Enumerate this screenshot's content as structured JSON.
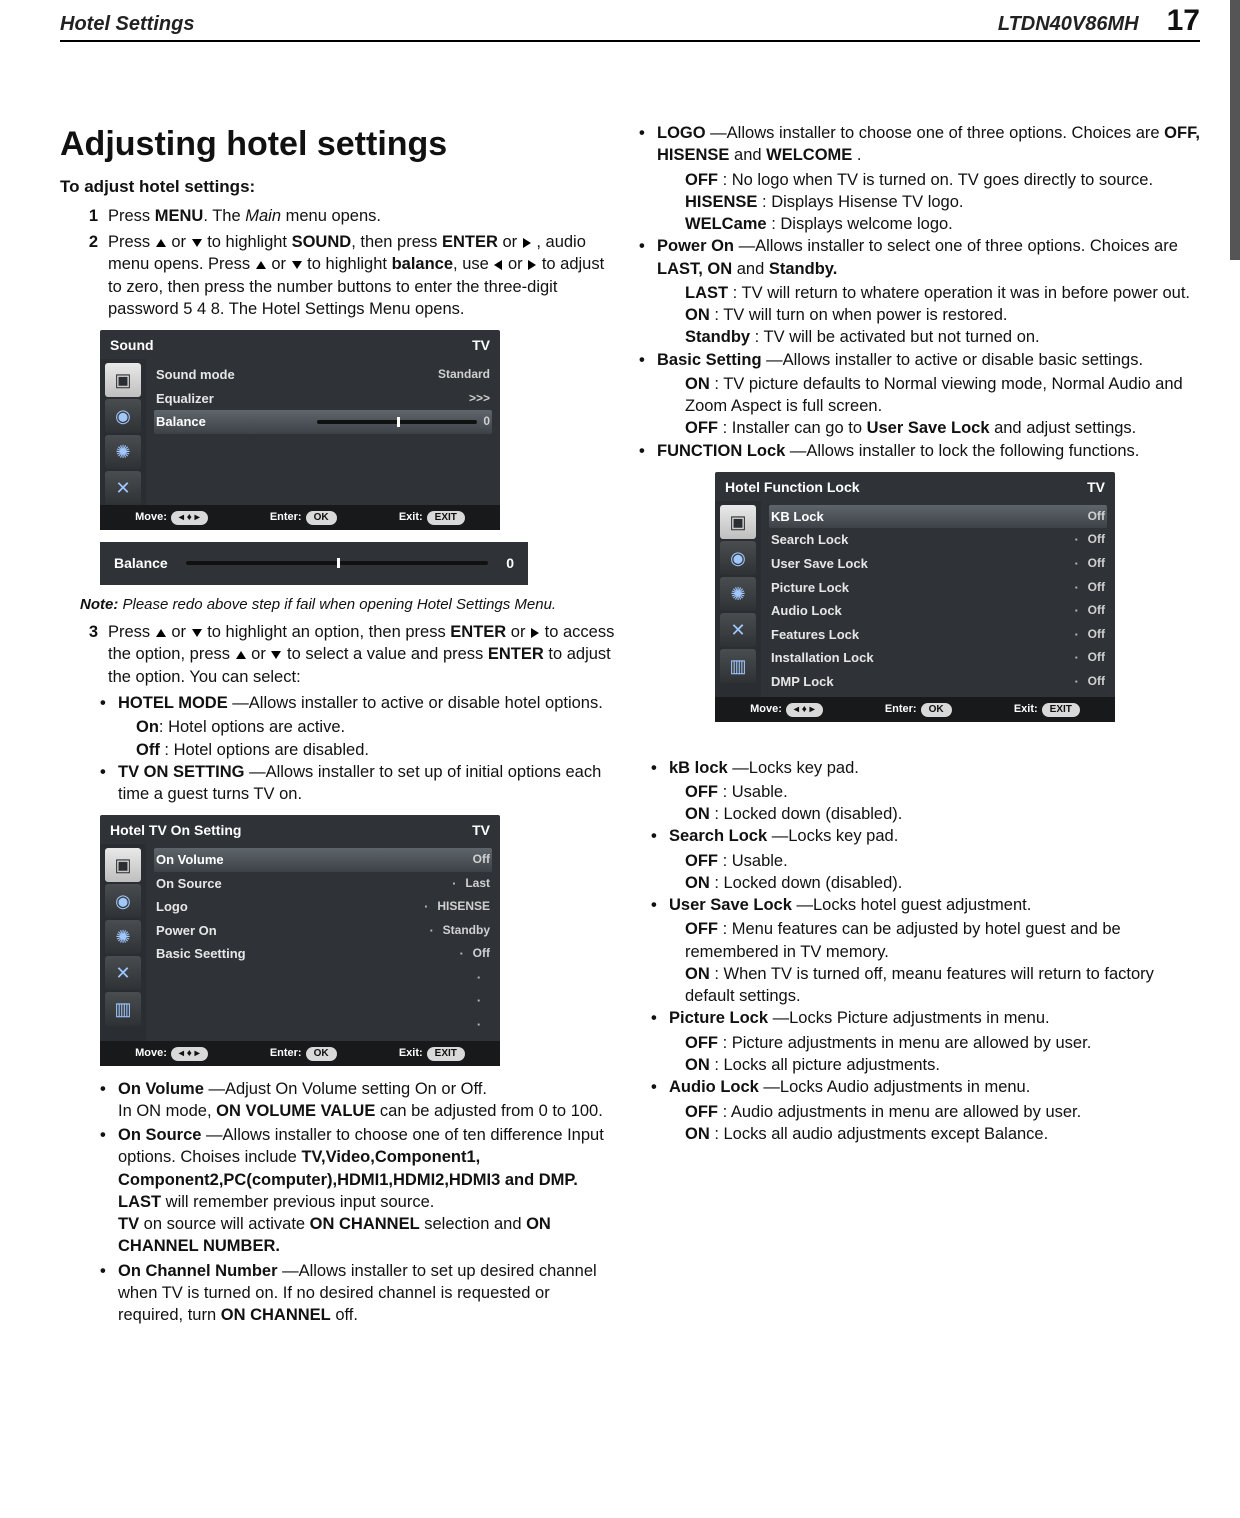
{
  "header": {
    "section": "Hotel Settings",
    "model": "LTDN40V86MH",
    "page": "17"
  },
  "title": "Adjusting hotel settings",
  "intro": "To adjust hotel settings:",
  "step1": {
    "n": "1",
    "pre": "Press ",
    "menu": "MENU",
    "mid": ". The ",
    "main": "Main",
    "post": " menu opens."
  },
  "step2": {
    "n": "2",
    "pre": "Press ",
    "or": " or ",
    "a1": " to highlight ",
    "sound": "SOUND",
    "a2": ", then press ",
    "enter": "ENTER",
    "a3": " or ",
    "a4": " , audio menu opens. Press ",
    "a5": " to highlight ",
    "balance": "balance",
    "a6": ", use ",
    "a7": " to adjust to zero, then press the number buttons to enter the three-digit password 5 4 8. The Hotel Settings Menu opens."
  },
  "osd_sound": {
    "title": "Sound",
    "tv": "TV",
    "rows": [
      {
        "lab": "Sound mode",
        "val": "Standard"
      },
      {
        "lab": "Equalizer",
        "val": ">>>"
      }
    ],
    "balance_lab": "Balance",
    "balance_val": "0",
    "foot": {
      "move": "Move:",
      "enter": "Enter:",
      "exit": "Exit:",
      "ok": "OK",
      "exitbtn": "EXIT",
      "nav": "◂ ♦ ▸"
    }
  },
  "osd_balance_mini": {
    "lab": "Balance",
    "val": "0"
  },
  "note_label": "Note:",
  "note_text": " Please redo above step if fail when opening Hotel Settings Menu.",
  "step3": {
    "n": "3",
    "a1": "Press ",
    "a2": " or ",
    "a3": " to highlight an option, then press ",
    "enter": "ENTER",
    "a4": " or ",
    "a5": " to access the option, press ",
    "a6": " to select a value and press ",
    "enter2": "ENTER",
    "a7": " to adjust the option. You can select:"
  },
  "hotel_mode": {
    "title": "HOTEL MODE",
    "desc": " —Allows installer to active or disable hotel options.",
    "on": "On",
    "on_d": ": Hotel options are active.",
    "off": "Off",
    "off_d": " : Hotel options are disabled."
  },
  "tv_on_setting_b": {
    "title": "TV ON SETTING",
    "desc": " —Allows installer to set up of initial options each time a guest turns TV on."
  },
  "osd_tvon": {
    "title": "Hotel   TV On Setting",
    "tv": "TV",
    "rows": [
      {
        "lab": "On Volume",
        "val": "Off",
        "sel": true
      },
      {
        "lab": "On Source",
        "val": "Last"
      },
      {
        "lab": "Logo",
        "val": "HISENSE"
      },
      {
        "lab": "Power On",
        "val": "Standby"
      },
      {
        "lab": "Basic Seetting",
        "val": "Off"
      }
    ]
  },
  "on_volume": {
    "t": "On Volume",
    "d": " —Adjust On Volume setting On or Off.",
    "l2a": "In ON mode, ",
    "l2b": "ON VOLUME VALUE",
    "l2c": " can be adjusted  from 0 to 100."
  },
  "on_source": {
    "t": "On Source",
    "d": " —Allows installer to choose one of ten difference Input options. Choises include ",
    "opts": "TV,Video,Component1, Component2,PC(computer),HDMI1,HDMI2,HDMI3 and DMP.",
    "last": "LAST",
    "last_d": " will remember previous input source.",
    "tv": "TV",
    "tv_d": " on source will activate ",
    "onch": "ON CHANNEL",
    "sel": " selection and ",
    "on": "ON",
    "chnum": "CHANNEL NUMBER."
  },
  "on_ch_num": {
    "t": "On Channel Number",
    "d": " —Allows installer to set up desired channel when TV is turned on. If no desired channel is requested or required, turn ",
    "onch": "ON CHANNEL",
    "off": " off."
  },
  "logo": {
    "t": "LOGO",
    "d": " —Allows installer to choose one of three options. Choices are ",
    "opts": "OFF, HISENSE",
    "and": " and ",
    "wel": "WELCOME",
    "dot": " .",
    "off": "OFF",
    "off_d": " : No logo when TV is turned on. TV goes directly to source.",
    "h": "HISENSE",
    "h_d": " : Displays Hisense TV logo.",
    "w": "WELCame",
    "w_d": " : Displays welcome logo."
  },
  "power_on": {
    "t": "Power On",
    "d": " —Allows installer to select one of three options. Choices are ",
    "opts": "LAST, ON",
    "and": " and ",
    "sb": "Standby.",
    "last": "LAST",
    "last_d": " : TV will return to whatere operation it was in before power out.",
    "on": "ON",
    "on_d": " : TV will turn on when power is restored.",
    "st": "Standby",
    "st_d": " : TV will be activated but not turned on."
  },
  "basic_setting": {
    "t": "Basic Setting",
    "d": " —Allows installer to active or disable basic settings.",
    "on": "ON",
    "on_d": " : TV picture defaults to Normal viewing mode, Normal Audio and Zoom Aspect is full screen.",
    "off": "OFF",
    "off_d": " : Installer can go to ",
    "usl": "User Save Lock",
    "off_d2": " and adjust settings."
  },
  "function_lock": {
    "t": "FUNCTION Lock",
    "d": " —Allows installer to lock the following functions."
  },
  "osd_flock": {
    "title": "Hotel    Function Lock",
    "tv": "TV",
    "rows": [
      {
        "lab": "KB Lock",
        "val": "Off",
        "sel": true
      },
      {
        "lab": "Search Lock",
        "val": "Off"
      },
      {
        "lab": "User Save Lock",
        "val": "Off"
      },
      {
        "lab": "Picture Lock",
        "val": "Off"
      },
      {
        "lab": "Audio Lock",
        "val": "Off"
      },
      {
        "lab": "Features Lock",
        "val": "Off"
      },
      {
        "lab": "Installation Lock",
        "val": "Off"
      },
      {
        "lab": "DMP Lock",
        "val": "Off"
      }
    ]
  },
  "kb_lock": {
    "t": "kB lock",
    "d": " —Locks key pad.",
    "off": "OFF",
    "off_d": " : Usable.",
    "on": "ON",
    "on_d": " : Locked down (disabled)."
  },
  "search_lock": {
    "t": "Search Lock",
    "d": " —Locks key pad.",
    "off": "OFF",
    "off_d": " : Usable.",
    "on": "ON",
    "on_d": " : Locked down (disabled)."
  },
  "user_save_lock": {
    "t": "User Save Lock",
    "d": " —Locks hotel guest adjustment.",
    "off": "OFF",
    "off_d": " : Menu features can be adjusted by hotel guest and be remembered in TV memory.",
    "on": "ON",
    "on_d": " : When TV is turned off, meanu features will return to factory default settings."
  },
  "picture_lock": {
    "t": "Picture Lock",
    "d": " —Locks Picture adjustments in menu.",
    "off": "OFF",
    "off_d": " : Picture adjustments in menu are allowed by user.",
    "on": "ON",
    "on_d": " : Locks all picture adjustments."
  },
  "audio_lock": {
    "t": "Audio Lock",
    "d": " —Locks Audio adjustments in menu.",
    "off": "OFF",
    "off_d": " : Audio adjustments in menu are allowed by user.",
    "on": "ON",
    "on_d": " : Locks all audio adjustments except Balance."
  }
}
